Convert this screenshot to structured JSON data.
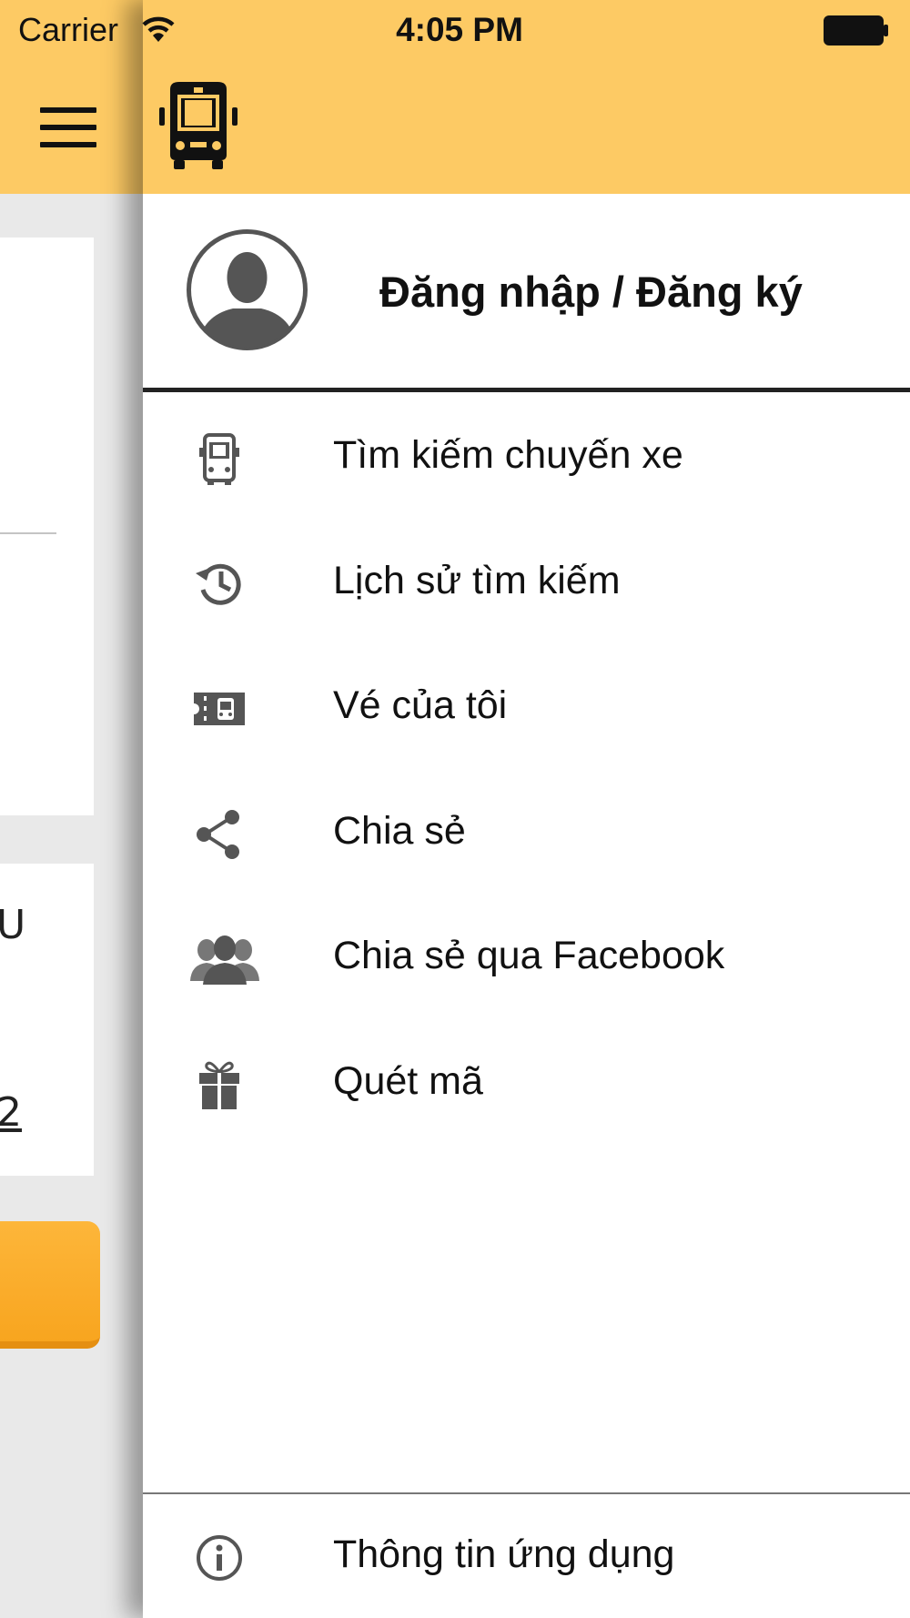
{
  "status_bar": {
    "carrier": "Carrier",
    "time": "4:05 PM"
  },
  "drawer": {
    "login_label": "Đăng nhập / Đăng ký",
    "menu": [
      {
        "label": "Tìm kiếm chuyến xe",
        "icon": "bus-icon"
      },
      {
        "label": "Lịch sử tìm kiếm",
        "icon": "history-icon"
      },
      {
        "label": "Vé của tôi",
        "icon": "ticket-icon"
      },
      {
        "label": "Chia sẻ",
        "icon": "share-icon"
      },
      {
        "label": "Chia sẻ qua Facebook",
        "icon": "group-icon"
      },
      {
        "label": "Quét mã",
        "icon": "gift-icon"
      }
    ],
    "footer_item": {
      "label": "Thông tin ứng dụng",
      "icon": "info-icon"
    }
  },
  "background_app": {
    "text1": "U",
    "text2": "2"
  },
  "colors": {
    "header": "#fdca64",
    "button": "#f8a51f",
    "icon": "#555555"
  }
}
